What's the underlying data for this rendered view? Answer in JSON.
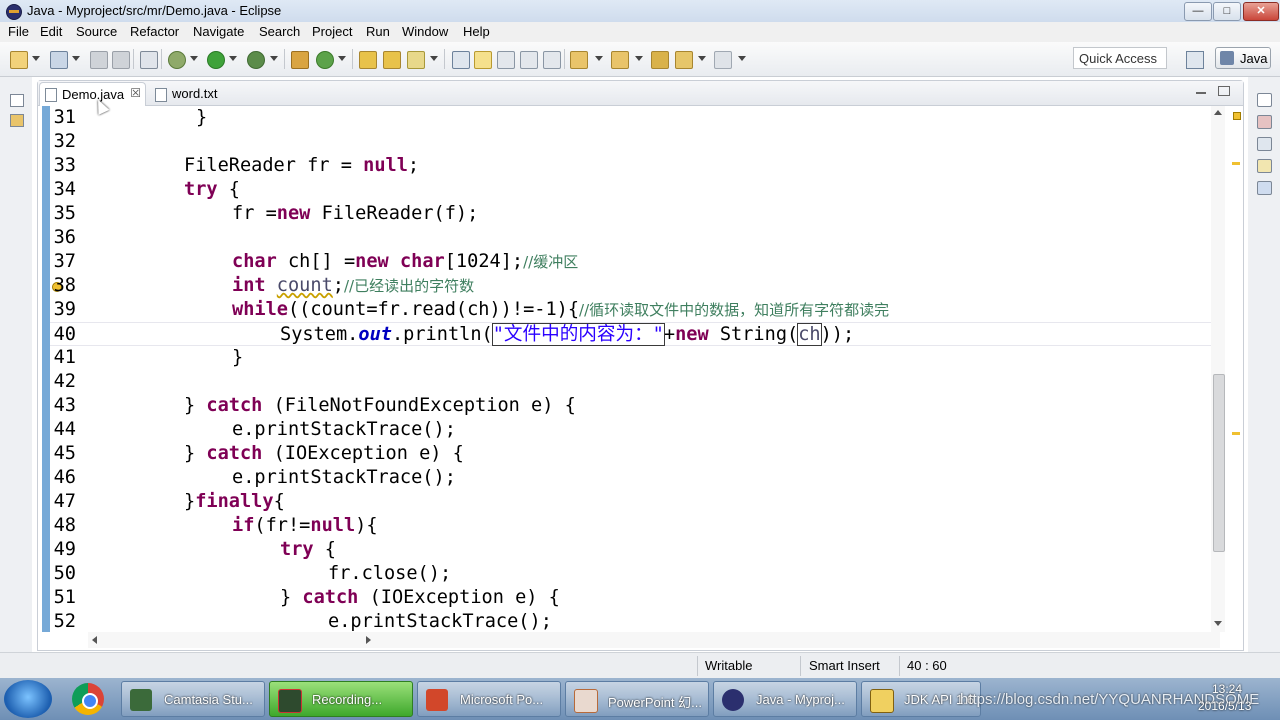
{
  "window": {
    "title": "Java - Myproject/src/mr/Demo.java - Eclipse",
    "minimize": "—",
    "maximize": "□",
    "close": "✕"
  },
  "menu": [
    "File",
    "Edit",
    "Source",
    "Refactor",
    "Navigate",
    "Search",
    "Project",
    "Run",
    "Window",
    "Help"
  ],
  "toolbar": {
    "quick_access": "Quick Access",
    "perspective": "Java"
  },
  "tabs": [
    {
      "label": "Demo.java",
      "close": "☒",
      "active": true
    },
    {
      "label": "word.txt",
      "active": false
    }
  ],
  "code_lines": [
    {
      "num": "31"
    },
    {
      "num": "32"
    },
    {
      "num": "33"
    },
    {
      "num": "34"
    },
    {
      "num": "35"
    },
    {
      "num": "36"
    },
    {
      "num": "37"
    },
    {
      "num": "38"
    },
    {
      "num": "39"
    },
    {
      "num": "40"
    },
    {
      "num": "41"
    },
    {
      "num": "42"
    },
    {
      "num": "43"
    },
    {
      "num": "44"
    },
    {
      "num": "45"
    },
    {
      "num": "46"
    },
    {
      "num": "47"
    },
    {
      "num": "48"
    },
    {
      "num": "49"
    },
    {
      "num": "50"
    },
    {
      "num": "51"
    },
    {
      "num": "52"
    }
  ],
  "code": {
    "l31": "}",
    "l33a": "FileReader fr = ",
    "l33b": "null",
    "l33c": ";",
    "l34a": "try",
    "l34b": " {",
    "l35a": "fr =",
    "l35b": "new",
    "l35c": " FileReader(f);",
    "l37a": "char",
    "l37b": " ch[] =",
    "l37c": "new",
    "l37d": " ",
    "l37e": "char",
    "l37f": "[1024];",
    "l37g": "//缓冲区",
    "l38a": "int",
    "l38b": " ",
    "l38c": "count",
    "l38d": ";",
    "l38e": "//已经读出的字符数",
    "l39a": "while",
    "l39b": "((count=fr.read(ch))!=-1){",
    "l39c": "//循环读取文件中的数据，知道所有字符都读完",
    "l40a": "System.",
    "l40b": "out",
    "l40c": ".println(",
    "l40d": "\"文件中的内容为：\"",
    "l40e": "+",
    "l40f": "new",
    "l40g": " String(",
    "l40h": "ch",
    "l40i": "));",
    "l41": "}",
    "l43a": "} ",
    "l43b": "catch",
    "l43c": " (FileNotFoundException e) {",
    "l44": "e.printStackTrace();",
    "l45a": "} ",
    "l45b": "catch",
    "l45c": " (IOException e) {",
    "l46": "e.printStackTrace();",
    "l47a": "}",
    "l47b": "finally",
    "l47c": "{",
    "l48a": "if",
    "l48b": "(fr!=",
    "l48c": "null",
    "l48d": "){",
    "l49a": "try",
    "l49b": " {",
    "l50": "fr.close();",
    "l51a": "} ",
    "l51b": "catch",
    "l51c": " (IOException e) {",
    "l52": "e.printStackTrace();"
  },
  "status": {
    "mode": "Writable",
    "insert": "Smart Insert",
    "position": "40 : 60"
  },
  "taskbar": {
    "items": [
      "Camtasia Stu...",
      "Recording...",
      "Microsoft Po...",
      "PowerPoint 幻...",
      "Java - Myproj...",
      "JDK API 1.6.0..."
    ],
    "watermark": "https://blog.csdn.net/YYQUANRHANDSOME",
    "time": "13:24",
    "date": "2016/5/13"
  },
  "colors": {
    "keyword": "#7f0055",
    "comment": "#3f7f5f",
    "string": "#2a00ff",
    "field": "#0000c0",
    "taskbar_active": "#3ea82c"
  }
}
